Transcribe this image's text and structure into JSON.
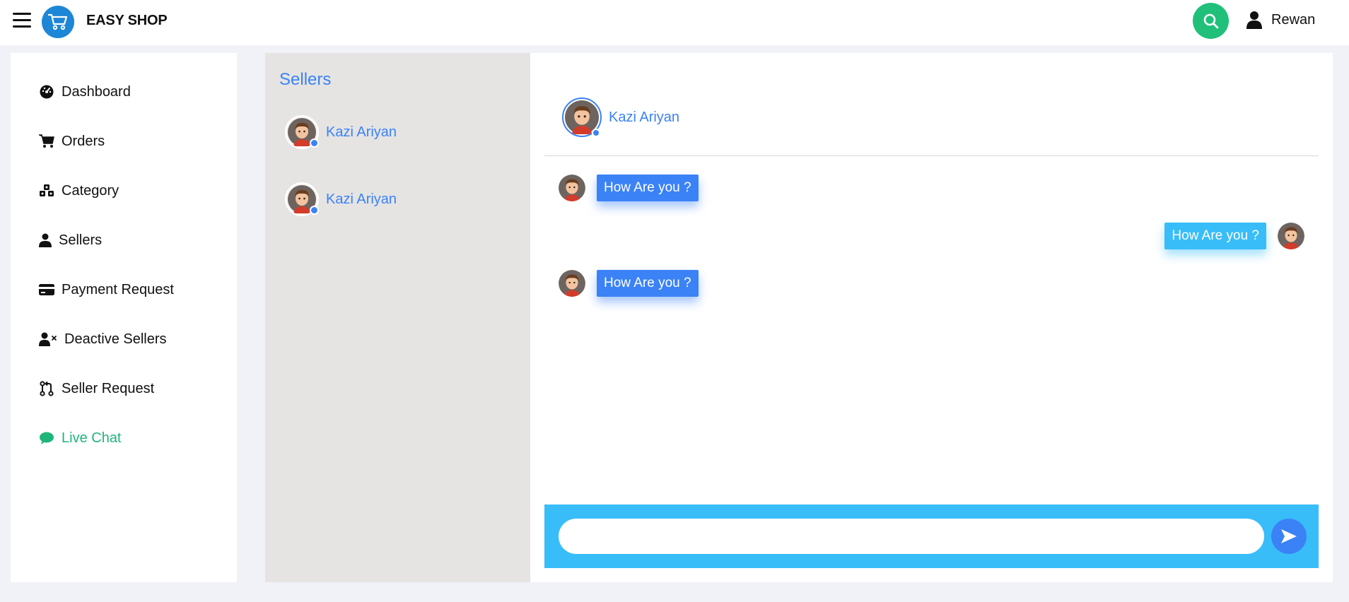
{
  "header": {
    "brand": "EASY SHOP",
    "user_name": "Rewan",
    "colors": {
      "search_button": "#20c07a",
      "logo_circle": "#1d86d6"
    }
  },
  "sidebar": {
    "items": [
      {
        "label": "Dashboard",
        "icon": "dashboard-icon",
        "active": false
      },
      {
        "label": "Orders",
        "icon": "cart-icon",
        "active": false
      },
      {
        "label": "Category",
        "icon": "cubes-icon",
        "active": false
      },
      {
        "label": "Sellers",
        "icon": "user-icon",
        "active": false
      },
      {
        "label": "Payment Request",
        "icon": "credit-card-icon",
        "active": false
      },
      {
        "label": "Deactive Sellers",
        "icon": "user-x-icon",
        "active": false
      },
      {
        "label": "Seller Request",
        "icon": "git-pull-request-icon",
        "active": false
      },
      {
        "label": "Live Chat",
        "icon": "chat-bubble-icon",
        "active": true
      }
    ],
    "active_color": "#1fb57a"
  },
  "sellers_panel": {
    "title": "Sellers",
    "sellers": [
      {
        "name": "Kazi Ariyan",
        "online": true
      },
      {
        "name": "Kazi Ariyan",
        "online": true
      }
    ]
  },
  "chat": {
    "header_name": "Kazi Ariyan",
    "messages": [
      {
        "text": "How Are you ?",
        "direction": "incoming"
      },
      {
        "text": "How Are you ?",
        "direction": "outgoing"
      },
      {
        "text": "How Are you ?",
        "direction": "incoming"
      }
    ],
    "composer": {
      "value": "",
      "placeholder": ""
    },
    "colors": {
      "incoming_bubble": "#3b82f6",
      "outgoing_bubble": "#38bdf8",
      "composer_bar": "#38bdf8"
    }
  }
}
